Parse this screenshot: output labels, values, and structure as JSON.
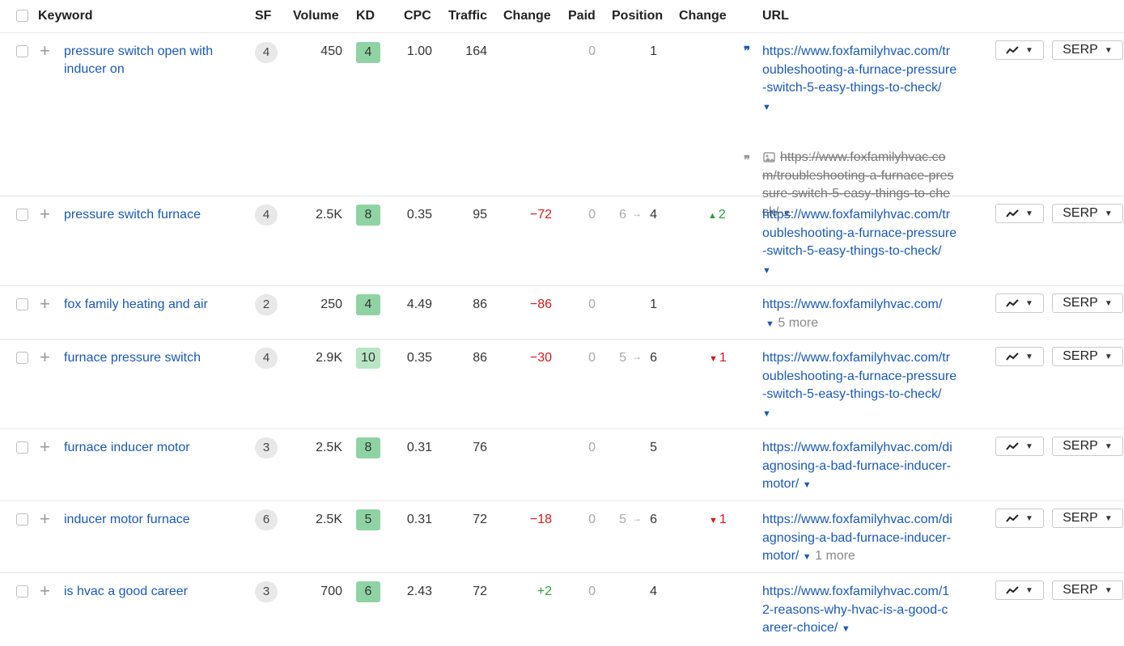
{
  "headers": {
    "keyword": "Keyword",
    "sf": "SF",
    "volume": "Volume",
    "kd": "KD",
    "cpc": "CPC",
    "traffic": "Traffic",
    "change": "Change",
    "paid": "Paid",
    "position": "Position",
    "pos_change": "Change",
    "url": "URL"
  },
  "serp_label": "SERP",
  "rows": [
    {
      "keyword_l1": "pressure switch open with",
      "keyword_l2": "inducer on",
      "sf": "4",
      "volume": "450",
      "kd": "4",
      "cpc": "1.00",
      "traffic": "164",
      "change": "",
      "paid": "0",
      "position": "1",
      "url_l1": "https://www.foxfamilyhvac.com/tr",
      "url_l2": "oubleshooting-a-furnace-pressure",
      "url_l3": "-switch-5-easy-things-to-check/",
      "old_url_l1": "https://www.foxfamilyhvac.co",
      "old_url_l2": "m/troubleshooting-a-furnace-pres",
      "old_url_l3": "sure-switch-5-easy-things-to-che",
      "old_url_l4": "ck/"
    },
    {
      "keyword": "pressure switch furnace",
      "sf": "4",
      "volume": "2.5K",
      "kd": "8",
      "cpc": "0.35",
      "traffic": "95",
      "change": "−72",
      "paid": "0",
      "pos_from": "6",
      "position": "4",
      "pos_change": "2",
      "url_l1": "https://www.foxfamilyhvac.com/tr",
      "url_l2": "oubleshooting-a-furnace-pressure",
      "url_l3": "-switch-5-easy-things-to-check/"
    },
    {
      "keyword": "fox family heating and air",
      "sf": "2",
      "volume": "250",
      "kd": "4",
      "cpc": "4.49",
      "traffic": "86",
      "change": "−86",
      "paid": "0",
      "position": "1",
      "url_l1": "https://www.foxfamilyhvac.com/",
      "more": "5 more"
    },
    {
      "keyword": "furnace pressure switch",
      "sf": "4",
      "volume": "2.9K",
      "kd": "10",
      "cpc": "0.35",
      "traffic": "86",
      "change": "−30",
      "paid": "0",
      "pos_from": "5",
      "position": "6",
      "pos_change": "1",
      "url_l1": "https://www.foxfamilyhvac.com/tr",
      "url_l2": "oubleshooting-a-furnace-pressure",
      "url_l3": "-switch-5-easy-things-to-check/"
    },
    {
      "keyword": "furnace inducer motor",
      "sf": "3",
      "volume": "2.5K",
      "kd": "8",
      "cpc": "0.31",
      "traffic": "76",
      "change": "",
      "paid": "0",
      "position": "5",
      "url_l1": "https://www.foxfamilyhvac.com/di",
      "url_l2": "agnosing-a-bad-furnace-inducer-",
      "url_l3": "motor/"
    },
    {
      "keyword": "inducer motor furnace",
      "sf": "6",
      "volume": "2.5K",
      "kd": "5",
      "cpc": "0.31",
      "traffic": "72",
      "change": "−18",
      "paid": "0",
      "pos_from": "5",
      "position": "6",
      "pos_change": "1",
      "url_l1": "https://www.foxfamilyhvac.com/di",
      "url_l2": "agnosing-a-bad-furnace-inducer-",
      "url_l3": "motor/",
      "more": "1 more"
    },
    {
      "keyword": "is hvac a good career",
      "sf": "3",
      "volume": "700",
      "kd": "6",
      "cpc": "2.43",
      "traffic": "72",
      "change": "+2",
      "paid": "0",
      "position": "4",
      "url_l1": "https://www.foxfamilyhvac.com/1",
      "url_l2": "2-reasons-why-hvac-is-a-good-c",
      "url_l3": "areer-choice/"
    }
  ]
}
